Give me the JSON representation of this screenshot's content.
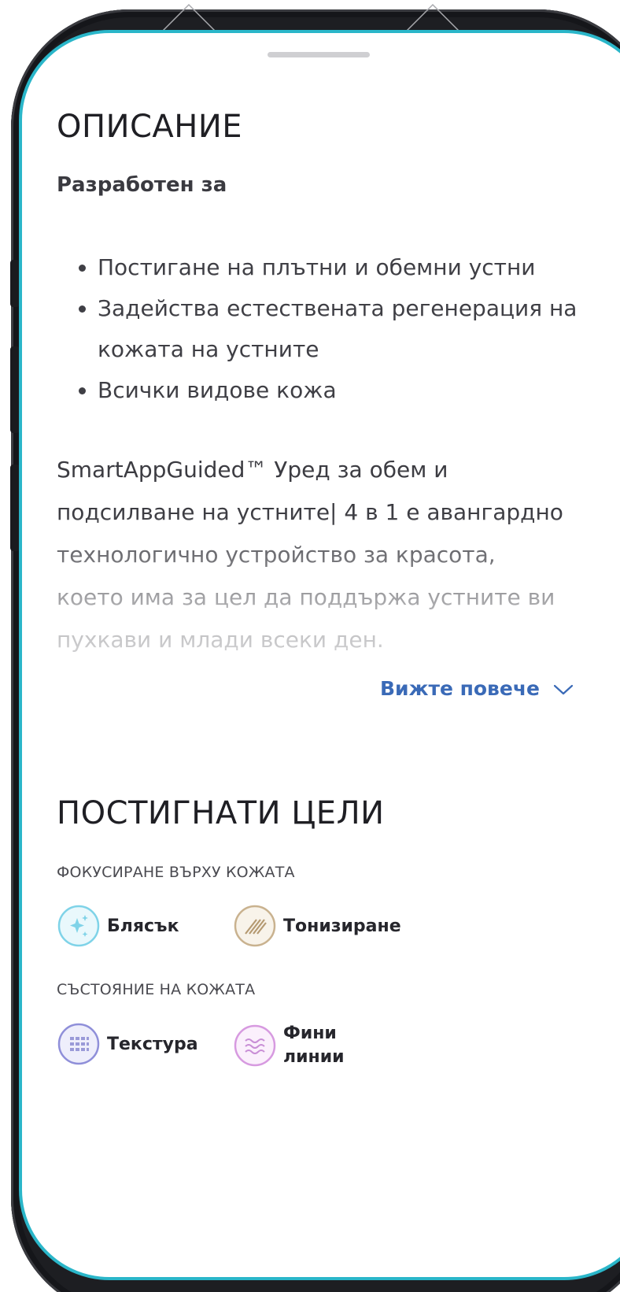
{
  "description": {
    "title": "ОПИСАНИЕ",
    "subheading": "Разработен за",
    "bullets": [
      "Постигане на плътни и обемни устни",
      "Задейства естествената регенерация на кожата на устните",
      "Всички видове кожа"
    ],
    "paragraph": "SmartAppGuided™ Уред за обем и подсилване на устните| 4 в 1 е авангардно технологично устройство за красота, което има за цел да поддържа устните ви пухкави и млади всеки ден.",
    "see_more": "Вижте повече",
    "see_more_icon": "chevron-down-icon"
  },
  "goals": {
    "title": "ПОСТИГНАТИ ЦЕЛИ",
    "groups": [
      {
        "label": "ФОКУСИРАНЕ ВЪРХУ КОЖАТА",
        "items": [
          {
            "label": "Блясък",
            "icon": "sparkle-icon",
            "color": "#7fd3e8"
          },
          {
            "label": "Тонизиране",
            "icon": "toning-icon",
            "color": "#c9b28f"
          }
        ]
      },
      {
        "label": "СЪСТОЯНИЕ НА КОЖАТА",
        "items": [
          {
            "label": "Текстура",
            "icon": "texture-icon",
            "color": "#8f8fd9"
          },
          {
            "label": "Фини линии",
            "line1": "Фини",
            "line2": "линии",
            "icon": "waves-icon",
            "color": "#d79ae0"
          }
        ]
      }
    ]
  },
  "colors": {
    "screen_border": "#2ab6c9",
    "link": "#3a6ab7",
    "phone_body": "#1d1e22"
  }
}
